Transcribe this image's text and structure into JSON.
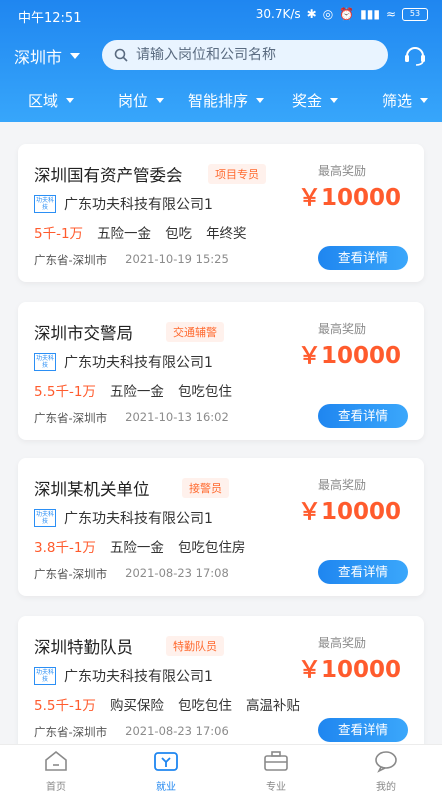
{
  "status": {
    "time": "中午12:51",
    "speed": "30.7K/s",
    "battery": "53"
  },
  "header": {
    "city": "深圳市",
    "search_placeholder": "请输入岗位和公司名称"
  },
  "filters": [
    "区域",
    "岗位",
    "智能排序",
    "奖金",
    "筛选"
  ],
  "jobs": [
    {
      "title": "深圳国有资产管委会",
      "tag": "项目专员",
      "company": "广东功夫科技有限公司1",
      "salary": "5千-1万",
      "benefits": [
        "五险一金",
        "包吃",
        "年终奖"
      ],
      "location": "广东省-深圳市",
      "date": "2021-10-19 15:25",
      "reward_label": "最高奖励",
      "reward": "￥10000",
      "button": "查看详情"
    },
    {
      "title": "深圳市交警局",
      "tag": "交通辅警",
      "company": "广东功夫科技有限公司1",
      "salary": "5.5千-1万",
      "benefits": [
        "五险一金",
        "包吃包住"
      ],
      "location": "广东省-深圳市",
      "date": "2021-10-13 16:02",
      "reward_label": "最高奖励",
      "reward": "￥10000",
      "button": "查看详情"
    },
    {
      "title": "深圳某机关单位",
      "tag": "接警员",
      "company": "广东功夫科技有限公司1",
      "salary": "3.8千-1万",
      "benefits": [
        "五险一金",
        "包吃包住房"
      ],
      "location": "广东省-深圳市",
      "date": "2021-08-23 17:08",
      "reward_label": "最高奖励",
      "reward": "￥10000",
      "button": "查看详情"
    },
    {
      "title": "深圳特勤队员",
      "tag": "特勤队员",
      "company": "广东功夫科技有限公司1",
      "salary": "5.5千-1万",
      "benefits": [
        "购买保险",
        "包吃包住",
        "高温补贴"
      ],
      "location": "广东省-深圳市",
      "date": "2021-08-23 17:06",
      "reward_label": "最高奖励",
      "reward": "￥10000",
      "button": "查看详情"
    }
  ],
  "company_logo_text": "功夫科技",
  "nav": [
    {
      "label": "首页",
      "icon": "home-icon",
      "active": false
    },
    {
      "label": "就业",
      "icon": "job-icon",
      "active": true
    },
    {
      "label": "专业",
      "icon": "briefcase-icon",
      "active": false
    },
    {
      "label": "我的",
      "icon": "profile-icon",
      "active": false
    }
  ],
  "colors": {
    "primary": "#1f86f0",
    "accent": "#ff5b2d"
  }
}
